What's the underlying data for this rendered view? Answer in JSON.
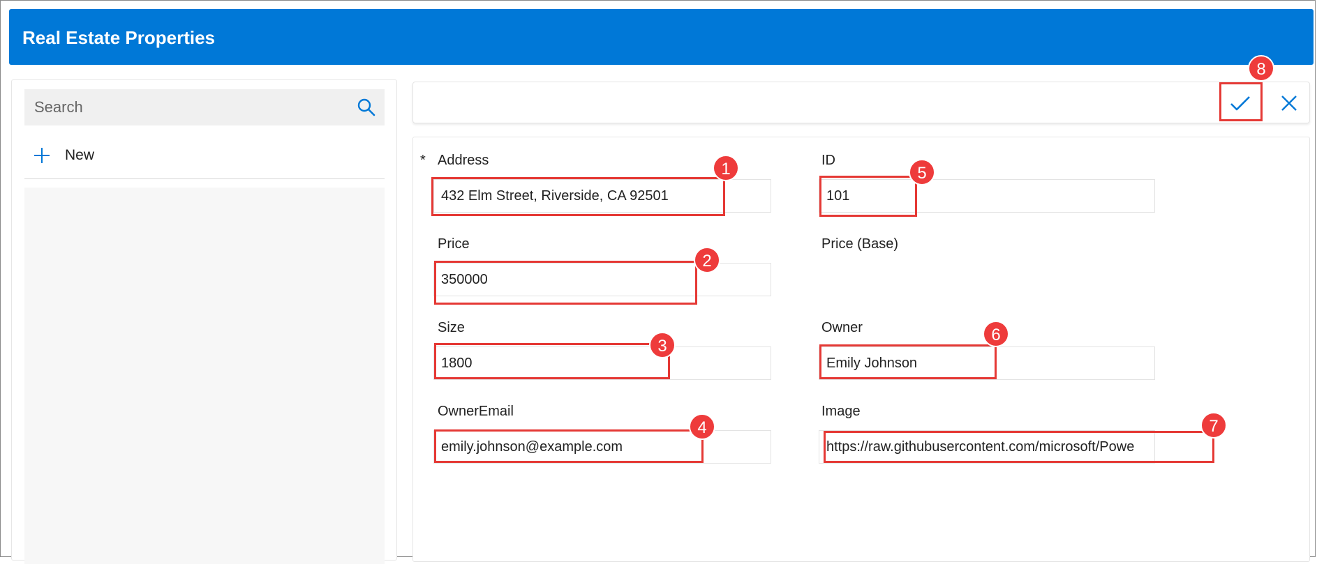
{
  "app": {
    "title": "Real Estate Properties"
  },
  "browse": {
    "search_placeholder": "Search",
    "search_icon": "search-icon",
    "new_label": "New",
    "new_icon": "plus-icon"
  },
  "toolbar": {
    "submit_icon": "checkmark-icon",
    "cancel_icon": "close-icon"
  },
  "form": {
    "required_marker": "*",
    "fields": {
      "address": {
        "label": "Address",
        "value": "432 Elm Street, Riverside, CA 92501"
      },
      "id": {
        "label": "ID",
        "value": "101"
      },
      "price": {
        "label": "Price",
        "value": "350000"
      },
      "price_base": {
        "label": "Price (Base)"
      },
      "size": {
        "label": "Size",
        "value": "1800"
      },
      "owner": {
        "label": "Owner",
        "value": "Emily Johnson"
      },
      "owner_email": {
        "label": "OwnerEmail",
        "value": "emily.johnson@example.com"
      },
      "image": {
        "label": "Image",
        "value": "https://raw.githubusercontent.com/microsoft/Powe"
      }
    }
  },
  "annotations": {
    "badges": [
      "1",
      "2",
      "3",
      "4",
      "5",
      "6",
      "7",
      "8"
    ],
    "color": "#e53935"
  },
  "colors": {
    "accent": "#0078d7",
    "header_text": "#ffffff"
  }
}
